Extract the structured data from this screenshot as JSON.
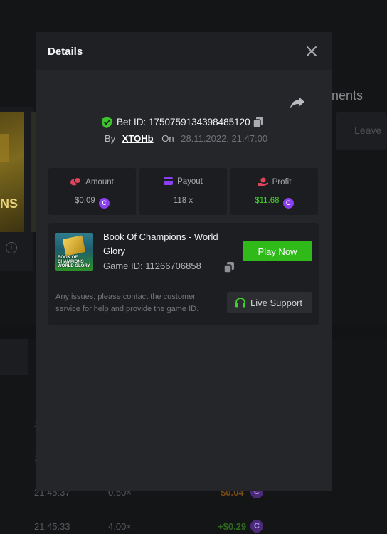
{
  "background": {
    "right_heading": "nents",
    "right_button": "Leave",
    "thumb_text": "NS",
    "info_icon": "info-icon",
    "rows": [
      {
        "time": "2",
        "multiplier": "",
        "profit": ""
      },
      {
        "time": "2",
        "multiplier": "",
        "profit": ""
      },
      {
        "time": "21:45:37",
        "multiplier": "0.50×",
        "profit": "$0.04"
      },
      {
        "time": "21:45:33",
        "multiplier": "4.00×",
        "profit": "+$0.29"
      }
    ],
    "coin_symbol": "C"
  },
  "modal": {
    "title": "Details",
    "close_icon": "close-icon",
    "share_icon": "share-icon",
    "bet": {
      "label": "Bet ID: 1750759134398485120",
      "by_label": "By",
      "user": "XTOHb",
      "on_label": "On",
      "date": "28.11.2022, 21:47:00"
    },
    "stats": [
      {
        "label": "Amount",
        "value": "$0.09",
        "icon": "coins-icon",
        "color": "#e0445a"
      },
      {
        "label": "Payout",
        "value": "118 x",
        "icon": "wallet-icon",
        "color": "#8a3ff0"
      },
      {
        "label": "Profit",
        "value": "$11.68",
        "icon": "hand-coin-icon",
        "color": "#e0445a"
      }
    ],
    "coin_symbol": "C",
    "game": {
      "title": "Book Of Champions - World Glory",
      "id_label": "Game ID: 11266706858",
      "thumb_text": "BOOK OF CHAMPIONS WORLD GLORY",
      "play_label": "Play Now",
      "issue_text": "Any issues, please contact the customer service for help and provide the game ID.",
      "support_label": "Live Support"
    },
    "colors": {
      "accent_green": "#2fba19",
      "profit_green": "#42d12e",
      "coin_purple": "#8a3ff0"
    }
  }
}
